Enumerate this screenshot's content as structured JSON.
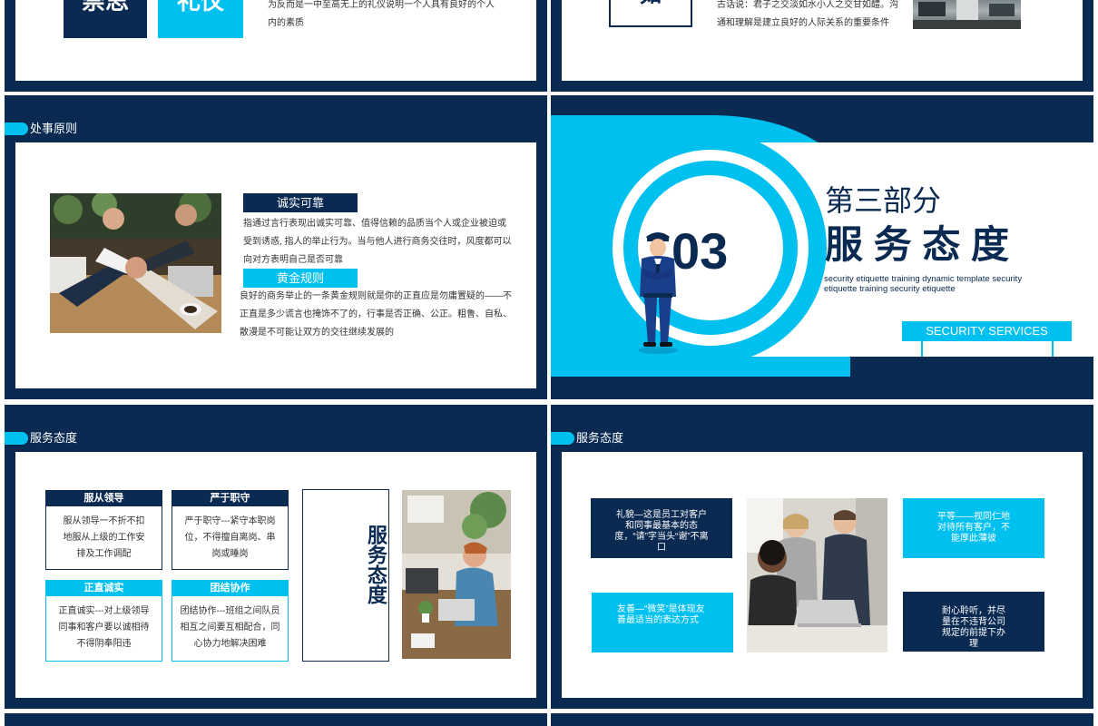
{
  "colors": {
    "navy": "#0a2a52",
    "cyan": "#00c0f0",
    "white": "#ffffff"
  },
  "s1": {
    "box1": "崇思",
    "box2": "礼仪",
    "text": "为反而是一中至高无上的礼仪说明一个人具有良好的个人内的素质"
  },
  "s2": {
    "box": "如",
    "text": "古话说：君子之交淡如水小人之交甘如醴。沟通和理解是建立良好的人际关系的重要条件"
  },
  "s3": {
    "title": "处事原则",
    "h1": "诚实可靠",
    "p1": "指通过言行表现出诚实可靠、值得信赖的品质当个人或企业被迫或受到诱惑, 指人的举止行为。当与他人进行商务交往时，风度都可以向对方表明自己是否可靠",
    "h2": "黄金规则",
    "p2": "良好的商务举止的一条黄金规则就是你的正直应是勿庸置疑的——不正直是多少谎言也掩饰不了的，行事是否正确、公正。粗鲁、自私、散漫是不可能让双方的交往继续发展的"
  },
  "s4": {
    "num": "03",
    "part": "第三部分",
    "title": "服 务 态 度",
    "sub": "security etiquette training dynamic template security etiquette training security etiquette",
    "badge": "SECURITY SERVICES"
  },
  "s5": {
    "title": "服务态度",
    "boxes": [
      {
        "h": "服从领导",
        "p": "服从领导一不折不扣地服从上级的工作安排及工作调配"
      },
      {
        "h": "严于职守",
        "p": "严于职守---紧守本职岗位，不得擅自离岗、串岗或睡岗"
      },
      {
        "h": "正直诚实",
        "p": "正直诚实---对上级领导同事和客户要以诚相待不得阴奉阳违"
      },
      {
        "h": "团结协作",
        "p": "团结协作---班组之间队员相互之间要互相配合，同心协力地解决困难"
      }
    ],
    "vertical": "服务态度"
  },
  "s6": {
    "title": "服务态度",
    "boxes": [
      "礼貌—这是员工对客户和同事最基本的态度，“请”字当头“谢”不离口",
      "平等——视同仁地对待所有客户，不能厚此薄彼",
      "友善—“微笑”是体现友善最适当的表达方式",
      "耐心聆听，并尽量在不违背公司规定的前提下办理"
    ]
  }
}
